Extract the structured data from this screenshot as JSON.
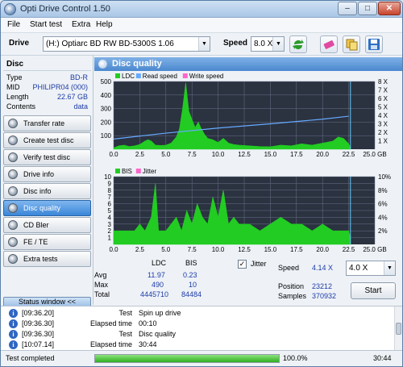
{
  "window": {
    "title": "Opti Drive Control 1.50",
    "min": "–",
    "max": "□",
    "close": "✕"
  },
  "menu": [
    "File",
    "Start test",
    "Extra",
    "Help"
  ],
  "toolbar": {
    "drive_label": "Drive",
    "drive_value": "(H:)  Optiarc BD RW BD-5300S 1.06",
    "speed_label": "Speed",
    "speed_value": "8.0 X"
  },
  "disc": {
    "heading": "Disc",
    "rows": [
      {
        "k": "Type",
        "v": "BD-R"
      },
      {
        "k": "MID",
        "v": "PHILIPR04 (000)"
      },
      {
        "k": "Length",
        "v": "22.67 GB"
      },
      {
        "k": "Contents",
        "v": "data"
      }
    ]
  },
  "nav": [
    "Transfer rate",
    "Create test disc",
    "Verify test disc",
    "Drive info",
    "Disc info",
    "Disc quality",
    "CD Bler",
    "FE / TE",
    "Extra tests"
  ],
  "nav_active": 5,
  "status_window_label": "Status window <<",
  "panel_title": "Disc quality",
  "chart_data": [
    {
      "type": "area",
      "legend": [
        "LDC",
        "Read speed",
        "Write speed"
      ],
      "colors": {
        "LDC": "#22cc22",
        "Read speed": "#66aaff",
        "Write speed": "#ff66cc"
      },
      "xlim": [
        0,
        25
      ],
      "ylim": [
        0,
        500
      ],
      "x_ticks": [
        0.0,
        2.5,
        5.0,
        7.5,
        10.0,
        12.5,
        15.0,
        17.5,
        20.0,
        22.5,
        25.0
      ],
      "x_unit": "GB",
      "y_ticks": [
        100,
        200,
        300,
        400,
        500
      ],
      "y2_ticks": [
        "1 X",
        "2 X",
        "3 X",
        "4 X",
        "5 X",
        "6 X",
        "7 X",
        "8 X"
      ],
      "ldc_profile": [
        [
          0.0,
          10
        ],
        [
          0.5,
          25
        ],
        [
          1.0,
          30
        ],
        [
          1.5,
          20
        ],
        [
          2.0,
          25
        ],
        [
          2.5,
          35
        ],
        [
          3.0,
          60
        ],
        [
          3.3,
          70
        ],
        [
          3.6,
          60
        ],
        [
          4.0,
          30
        ],
        [
          4.5,
          28
        ],
        [
          5.0,
          30
        ],
        [
          5.5,
          45
        ],
        [
          6.0,
          90
        ],
        [
          6.3,
          150
        ],
        [
          6.6,
          300
        ],
        [
          6.9,
          490
        ],
        [
          7.2,
          280
        ],
        [
          7.5,
          220
        ],
        [
          7.8,
          160
        ],
        [
          8.1,
          200
        ],
        [
          8.4,
          150
        ],
        [
          8.7,
          110
        ],
        [
          9.0,
          80
        ],
        [
          9.5,
          70
        ],
        [
          10.0,
          50
        ],
        [
          10.5,
          80
        ],
        [
          11.0,
          45
        ],
        [
          11.5,
          35
        ],
        [
          12.0,
          30
        ],
        [
          13.0,
          25
        ],
        [
          14.0,
          20
        ],
        [
          15.0,
          18
        ],
        [
          16.0,
          30
        ],
        [
          17.0,
          25
        ],
        [
          18.0,
          40
        ],
        [
          19.0,
          30
        ],
        [
          20.0,
          45
        ],
        [
          21.0,
          60
        ],
        [
          21.5,
          90
        ],
        [
          22.0,
          80
        ],
        [
          22.5,
          40
        ],
        [
          22.67,
          10
        ]
      ],
      "read_speed": [
        [
          0.0,
          1.2
        ],
        [
          5.0,
          1.9
        ],
        [
          10.0,
          2.5
        ],
        [
          15.0,
          3.0
        ],
        [
          20.0,
          3.55
        ],
        [
          22.5,
          3.9
        ]
      ]
    },
    {
      "type": "area",
      "legend": [
        "BIS",
        "Jitter"
      ],
      "colors": {
        "BIS": "#22cc22",
        "Jitter": "#ff66cc"
      },
      "xlim": [
        0,
        25
      ],
      "ylim": [
        0,
        10
      ],
      "x_ticks": [
        0.0,
        2.5,
        5.0,
        7.5,
        10.0,
        12.5,
        15.0,
        17.5,
        20.0,
        22.5,
        25.0
      ],
      "x_unit": "GB",
      "y_ticks": [
        1,
        2,
        3,
        4,
        5,
        6,
        7,
        8,
        9,
        10
      ],
      "y2_ticks": [
        "2%",
        "4%",
        "6%",
        "8%",
        "10%"
      ],
      "bis_profile": [
        [
          0.0,
          2
        ],
        [
          1.0,
          2
        ],
        [
          2.0,
          2
        ],
        [
          2.5,
          3
        ],
        [
          3.0,
          2
        ],
        [
          3.6,
          4
        ],
        [
          4.0,
          9
        ],
        [
          4.3,
          2
        ],
        [
          5.0,
          2
        ],
        [
          5.5,
          3
        ],
        [
          6.0,
          4
        ],
        [
          6.5,
          2
        ],
        [
          7.0,
          5
        ],
        [
          7.5,
          3
        ],
        [
          8.0,
          6
        ],
        [
          8.5,
          4
        ],
        [
          9.0,
          3
        ],
        [
          9.5,
          7
        ],
        [
          10.0,
          4
        ],
        [
          10.5,
          8
        ],
        [
          11.0,
          3
        ],
        [
          11.5,
          4
        ],
        [
          12.0,
          3
        ],
        [
          13.0,
          3
        ],
        [
          14.0,
          2
        ],
        [
          15.0,
          3
        ],
        [
          16.0,
          4
        ],
        [
          17.0,
          3
        ],
        [
          18.0,
          3
        ],
        [
          19.0,
          2
        ],
        [
          20.0,
          3
        ],
        [
          21.0,
          2
        ],
        [
          22.0,
          2
        ],
        [
          22.5,
          2
        ],
        [
          22.67,
          1
        ]
      ]
    }
  ],
  "stats": {
    "col_ldc": "LDC",
    "col_bis": "BIS",
    "rows": [
      {
        "k": "Avg",
        "ldc": "11.97",
        "bis": "0.23"
      },
      {
        "k": "Max",
        "ldc": "490",
        "bis": "10"
      },
      {
        "k": "Total",
        "ldc": "4445710",
        "bis": "84484"
      }
    ],
    "jitter_label": "Jitter",
    "jitter_checked": true,
    "speed_label": "Speed",
    "speed_value": "4.14 X",
    "speed_select": "4.0 X",
    "position_label": "Position",
    "position_value": "23212",
    "samples_label": "Samples",
    "samples_value": "370932",
    "start_label": "Start"
  },
  "log": [
    {
      "time": "[09:36.20]",
      "k": "Test",
      "v": "Spin up drive"
    },
    {
      "time": "[09:36.30]",
      "k": "Elapsed time",
      "v": "00:10"
    },
    {
      "time": "[09:36.30]",
      "k": "Test",
      "v": "Disc quality"
    },
    {
      "time": "[10:07.14]",
      "k": "Elapsed time",
      "v": "30:44"
    }
  ],
  "statusbar": {
    "text": "Test completed",
    "progress": 100.0,
    "progress_text": "100.0%",
    "elapsed": "30:44"
  }
}
